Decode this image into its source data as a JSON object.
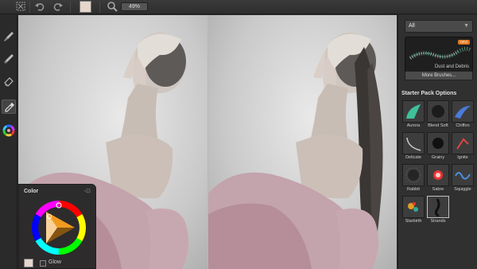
{
  "toolbar": {
    "zoom_value": "49%",
    "icons": [
      "selection-icon",
      "undo-icon",
      "redo-icon",
      "color-swatch",
      "zoom-icon"
    ],
    "current_color": "#e6d6cc"
  },
  "left_tools": [
    "brush-icon",
    "smudge-icon",
    "eraser-icon",
    "eyedropper-icon",
    "color-wheel-icon"
  ],
  "color_panel": {
    "title": "Color",
    "glow_label": "Glow",
    "glow_checked": false,
    "current_color": "#e6d6cc"
  },
  "brush_panel": {
    "category": "All",
    "featured_brush": "Dust and Debris",
    "featured_badge": "NEW",
    "more_button": "More Brushes...",
    "section_title": "Starter Pack Options",
    "brushes": [
      {
        "label": "Aurora"
      },
      {
        "label": "Blend Soft"
      },
      {
        "label": "Chiffon"
      },
      {
        "label": "Delicate"
      },
      {
        "label": "Grainy"
      },
      {
        "label": "Ignite"
      },
      {
        "label": "Rabbit"
      },
      {
        "label": "Sabre"
      },
      {
        "label": "Squiggle"
      },
      {
        "label": "Starbirth"
      },
      {
        "label": "Strands",
        "selected": true
      }
    ]
  }
}
